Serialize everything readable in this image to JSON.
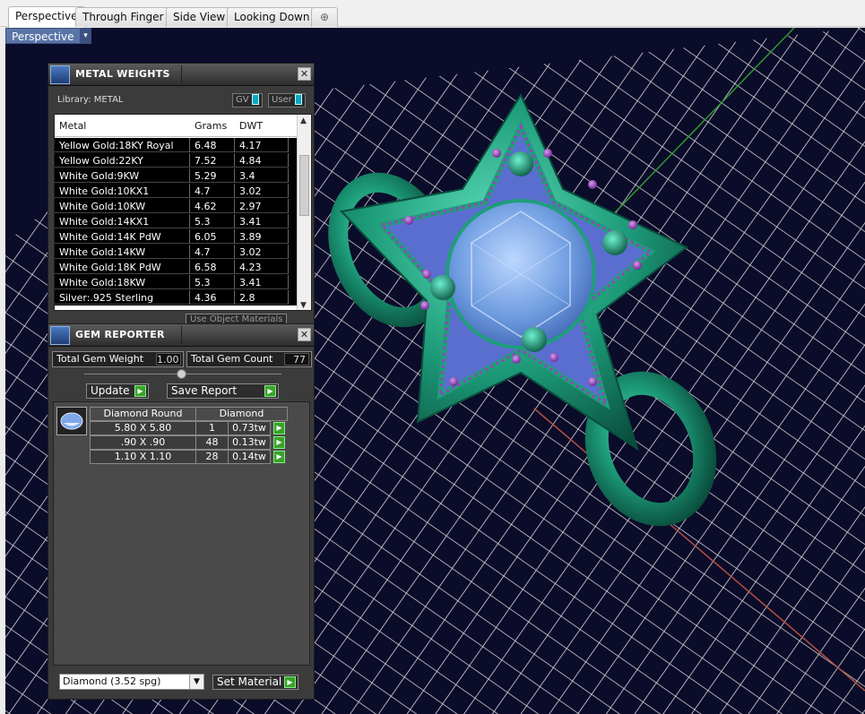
{
  "tabs": [
    {
      "label": "Perspective",
      "active": true
    },
    {
      "label": "Through Finger",
      "active": false
    },
    {
      "label": "Side View",
      "active": false
    },
    {
      "label": "Looking Down",
      "active": false
    },
    {
      "label": "⊕",
      "active": false
    }
  ],
  "viewport": {
    "label": "Perspective",
    "dropdown": "▾"
  },
  "metal_weights": {
    "title": "METAL WEIGHTS",
    "close": "✕",
    "library_label": "Library: METAL",
    "toggle_gv": "GV",
    "toggle_user": "User",
    "columns": [
      "Metal",
      "Grams",
      "DWT"
    ],
    "rows": [
      {
        "metal": "Yellow Gold:18KY Royal",
        "grams": "6.48",
        "dwt": "4.17"
      },
      {
        "metal": "Yellow Gold:22KY",
        "grams": "7.52",
        "dwt": "4.84"
      },
      {
        "metal": "White Gold:9KW",
        "grams": "5.29",
        "dwt": "3.4"
      },
      {
        "metal": "White Gold:10KX1",
        "grams": "4.7",
        "dwt": "3.02"
      },
      {
        "metal": "White Gold:10KW",
        "grams": "4.62",
        "dwt": "2.97"
      },
      {
        "metal": "White Gold:14KX1",
        "grams": "5.3",
        "dwt": "3.41"
      },
      {
        "metal": "White Gold:14K PdW",
        "grams": "6.05",
        "dwt": "3.89"
      },
      {
        "metal": "White Gold:14KW",
        "grams": "4.7",
        "dwt": "3.02"
      },
      {
        "metal": "White Gold:18K PdW",
        "grams": "6.58",
        "dwt": "4.23"
      },
      {
        "metal": "White Gold:18KW",
        "grams": "5.3",
        "dwt": "3.41"
      },
      {
        "metal": "Silver:.925 Sterling",
        "grams": "4.36",
        "dwt": "2.8"
      }
    ],
    "use_object_materials": "Use Object Materials"
  },
  "gem_reporter": {
    "title": "GEM REPORTER",
    "close": "✕",
    "total_weight_label": "Total Gem Weight",
    "total_weight_value": "1.00",
    "total_count_label": "Total Gem Count",
    "total_count_value": "77",
    "update_label": "Update",
    "save_report_label": "Save Report",
    "gem_columns": [
      "Diamond Round",
      "Diamond"
    ],
    "gems": [
      {
        "size": "5.80 X 5.80",
        "count": "1",
        "weight": "0.73tw"
      },
      {
        "size": ".90 X .90",
        "count": "48",
        "weight": "0.13tw"
      },
      {
        "size": "1.10 X 1.10",
        "count": "28",
        "weight": "0.14tw"
      }
    ],
    "material_select": "Diamond     (3.52 spg)",
    "set_material_label": "Set Material"
  },
  "colors": {
    "viewport_bg": "#0b0b2a",
    "grid": "#d8d8d8",
    "ring_metal": "#1f9e7a",
    "stone": "#6f9de0",
    "accent_gems": "#8b3fb0",
    "button_green": "#3aa22a"
  }
}
